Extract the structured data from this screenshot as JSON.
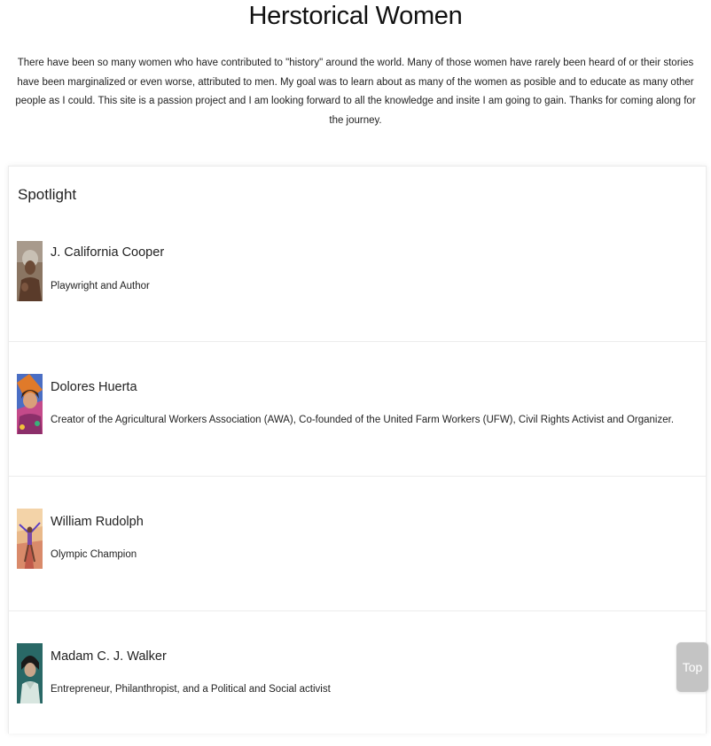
{
  "header": {
    "title": "Herstorical Women",
    "intro": "There have been so many women who have contributed to \"history\" around the world. Many of those women have rarely been heard of or their stories have been marginalized or even worse, attributed to men. My goal was to learn about as many of the women as posible and to educate as many other people as I could. This site is a passion project and I am looking forward to all the knowledge and insite I am going to gain. Thanks for coming along for the journey."
  },
  "spotlight": {
    "title": "Spotlight",
    "items": [
      {
        "name": "J. California Cooper",
        "description": "Playwright and Author",
        "image_icon": "portrait-photo"
      },
      {
        "name": "Dolores Huerta",
        "description": "Creator of the Agricultural Workers Association (AWA), Co-founded of the United Farm Workers (UFW), Civil Rights Activist and Organizer.",
        "image_icon": "portrait-painting"
      },
      {
        "name": "William Rudolph",
        "description": "Olympic Champion",
        "image_icon": "runner-illustration"
      },
      {
        "name": "Madam C. J. Walker",
        "description": "Entrepreneur, Philanthropist, and a Political and Social activist",
        "image_icon": "portrait-photo"
      }
    ]
  },
  "scroll_top": {
    "label": "Top"
  },
  "colors": {
    "button_bg": "#c4c4c4",
    "divider": "#ececec",
    "text": "#222222"
  }
}
